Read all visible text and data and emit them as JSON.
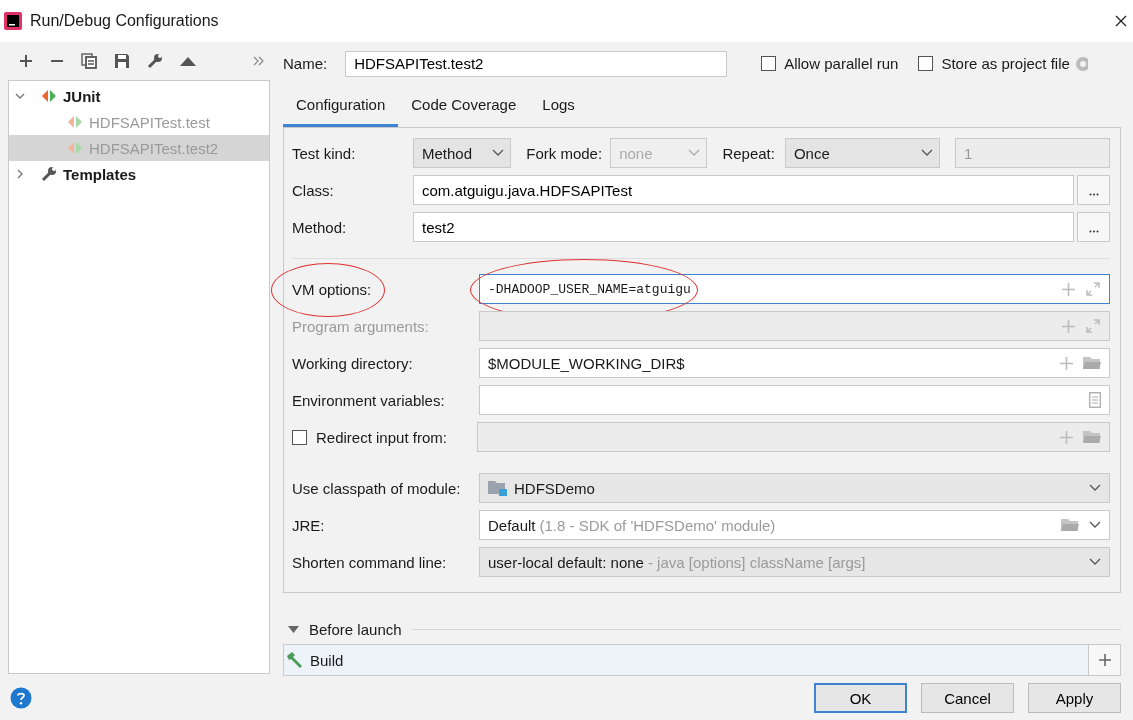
{
  "window": {
    "title": "Run/Debug Configurations"
  },
  "tree": [
    {
      "label": "JUnit",
      "kind": "group",
      "expanded": true,
      "selected": false,
      "children": [
        {
          "label": "HDFSAPITest.test",
          "selected": false
        },
        {
          "label": "HDFSAPITest.test2",
          "selected": true
        }
      ]
    },
    {
      "label": "Templates",
      "kind": "templates",
      "expanded": false,
      "selected": false
    }
  ],
  "name": {
    "label": "Name:",
    "value": "HDFSAPITest.test2"
  },
  "options": [
    {
      "label": "Allow parallel run",
      "checked": false
    },
    {
      "label": "Store as project file",
      "checked": false
    }
  ],
  "tabs": [
    {
      "label": "Configuration",
      "selected": true
    },
    {
      "label": "Code Coverage",
      "selected": false
    },
    {
      "label": "Logs",
      "selected": false
    }
  ],
  "test_kind": {
    "label": "Test kind:",
    "value": "Method"
  },
  "fork_mode": {
    "label": "Fork mode:",
    "value": "none",
    "disabled": true
  },
  "repeat": {
    "label": "Repeat:",
    "value": "Once",
    "count": "1"
  },
  "upper_rows": [
    {
      "label": "Class:",
      "value": "com.atguigu.java.HDFSAPITest"
    },
    {
      "label": "Method:",
      "value": "test2"
    }
  ],
  "rows": [
    {
      "kind": "expandable",
      "label": "VM options:",
      "value": "-DHADOOP_USER_NAME=atguigu",
      "disabled": false,
      "focused": true,
      "annotated": true
    },
    {
      "kind": "expandable",
      "label": "Program arguments:",
      "disabled": true,
      "focused": false,
      "annotated": false
    },
    {
      "kind": "path",
      "label": "Working directory:",
      "value": "$MODULE_WORKING_DIR$",
      "disabled": false
    },
    {
      "kind": "env",
      "label": "Environment variables:"
    },
    {
      "kind": "redirect",
      "label": "Redirect input from:",
      "checked": false,
      "disabled": true
    }
  ],
  "lower_rows": [
    {
      "kind": "module",
      "label": "Use classpath of module:",
      "value": "HDFSDemo"
    },
    {
      "kind": "jre",
      "label": "JRE:",
      "value": "Default",
      "hint": "(1.8 - SDK of 'HDFSDemo' module)"
    },
    {
      "kind": "shorten",
      "label": "Shorten command line:",
      "value": "user-local default: none",
      "hint": "- java [options] className [args]"
    }
  ],
  "before_launch": {
    "label": "Before launch",
    "expanded": true,
    "tasks": [
      "Build"
    ]
  },
  "buttons": [
    {
      "label": "OK",
      "default": true
    },
    {
      "label": "Cancel",
      "default": false
    },
    {
      "label": "Apply",
      "default": false
    }
  ]
}
